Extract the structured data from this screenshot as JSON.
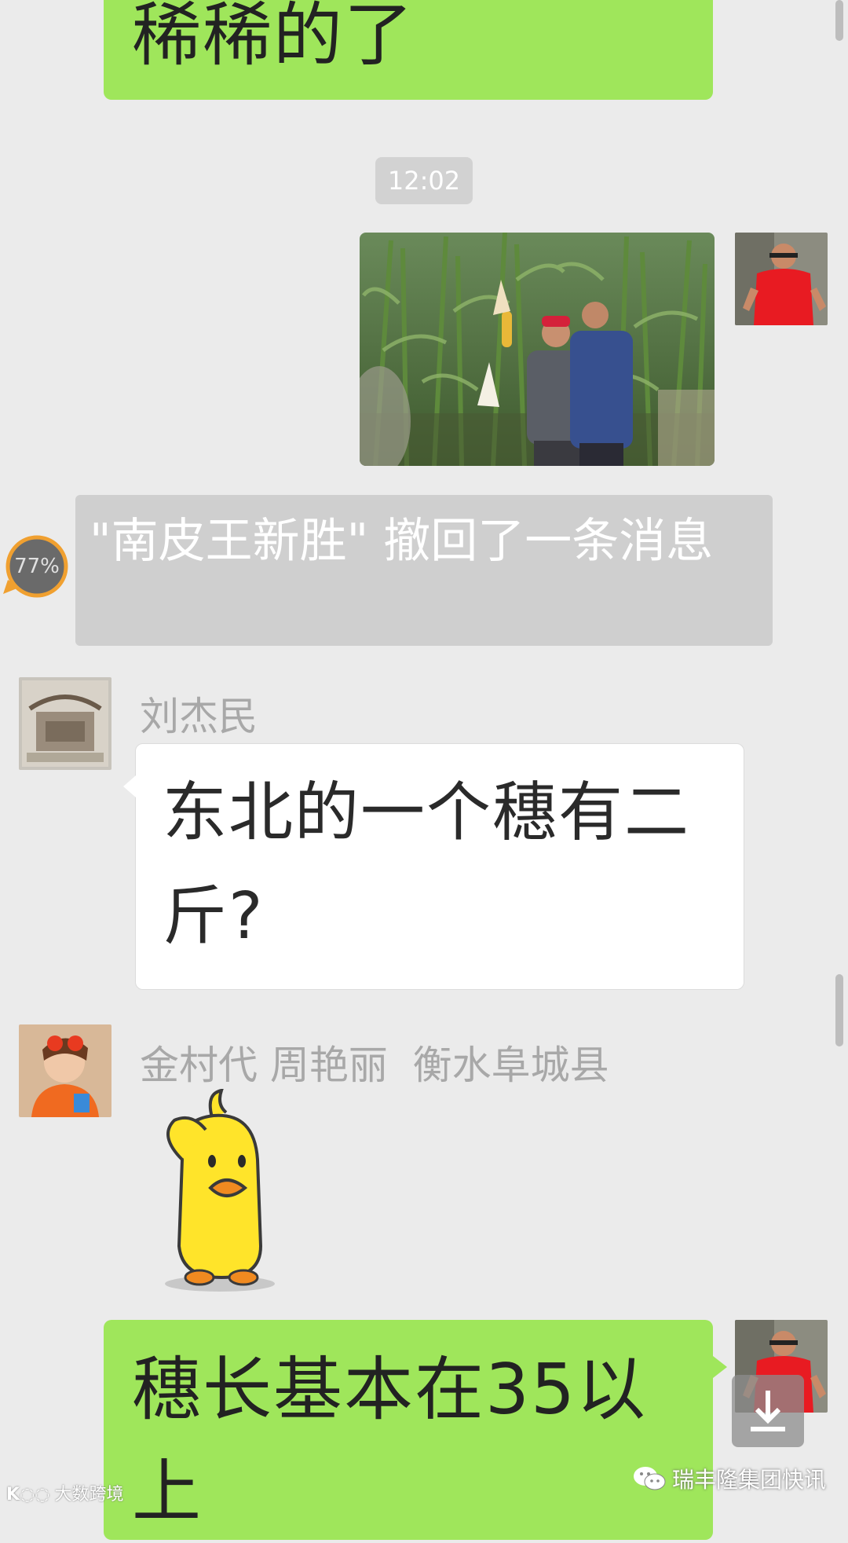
{
  "messages": {
    "top_partial": "稀稀的了",
    "timestamp": "12:02",
    "recall_notice": "\"南皮王新胜\" 撤回了一条消息",
    "sender_1_name": "刘杰民",
    "sender_1_text": "东北的一个穗有二斤?",
    "sender_2_name": "金村代 周艳丽  衡水阜城县",
    "bottom_text": "穗长基本在35以上"
  },
  "progress": {
    "label": "77%",
    "value": 0.77
  },
  "watermarks": {
    "left": "大数跨境",
    "right": "瑞丰隆集团快讯"
  },
  "colors": {
    "green_bubble": "#9fe65b",
    "background": "#ebebeb",
    "recall_bg": "#cfcfcf",
    "progress_ring": "#f0a030"
  },
  "icons": {
    "download": "download-icon",
    "sticker": "yellow-duck-salute-sticker",
    "wechat": "wechat-icon"
  }
}
